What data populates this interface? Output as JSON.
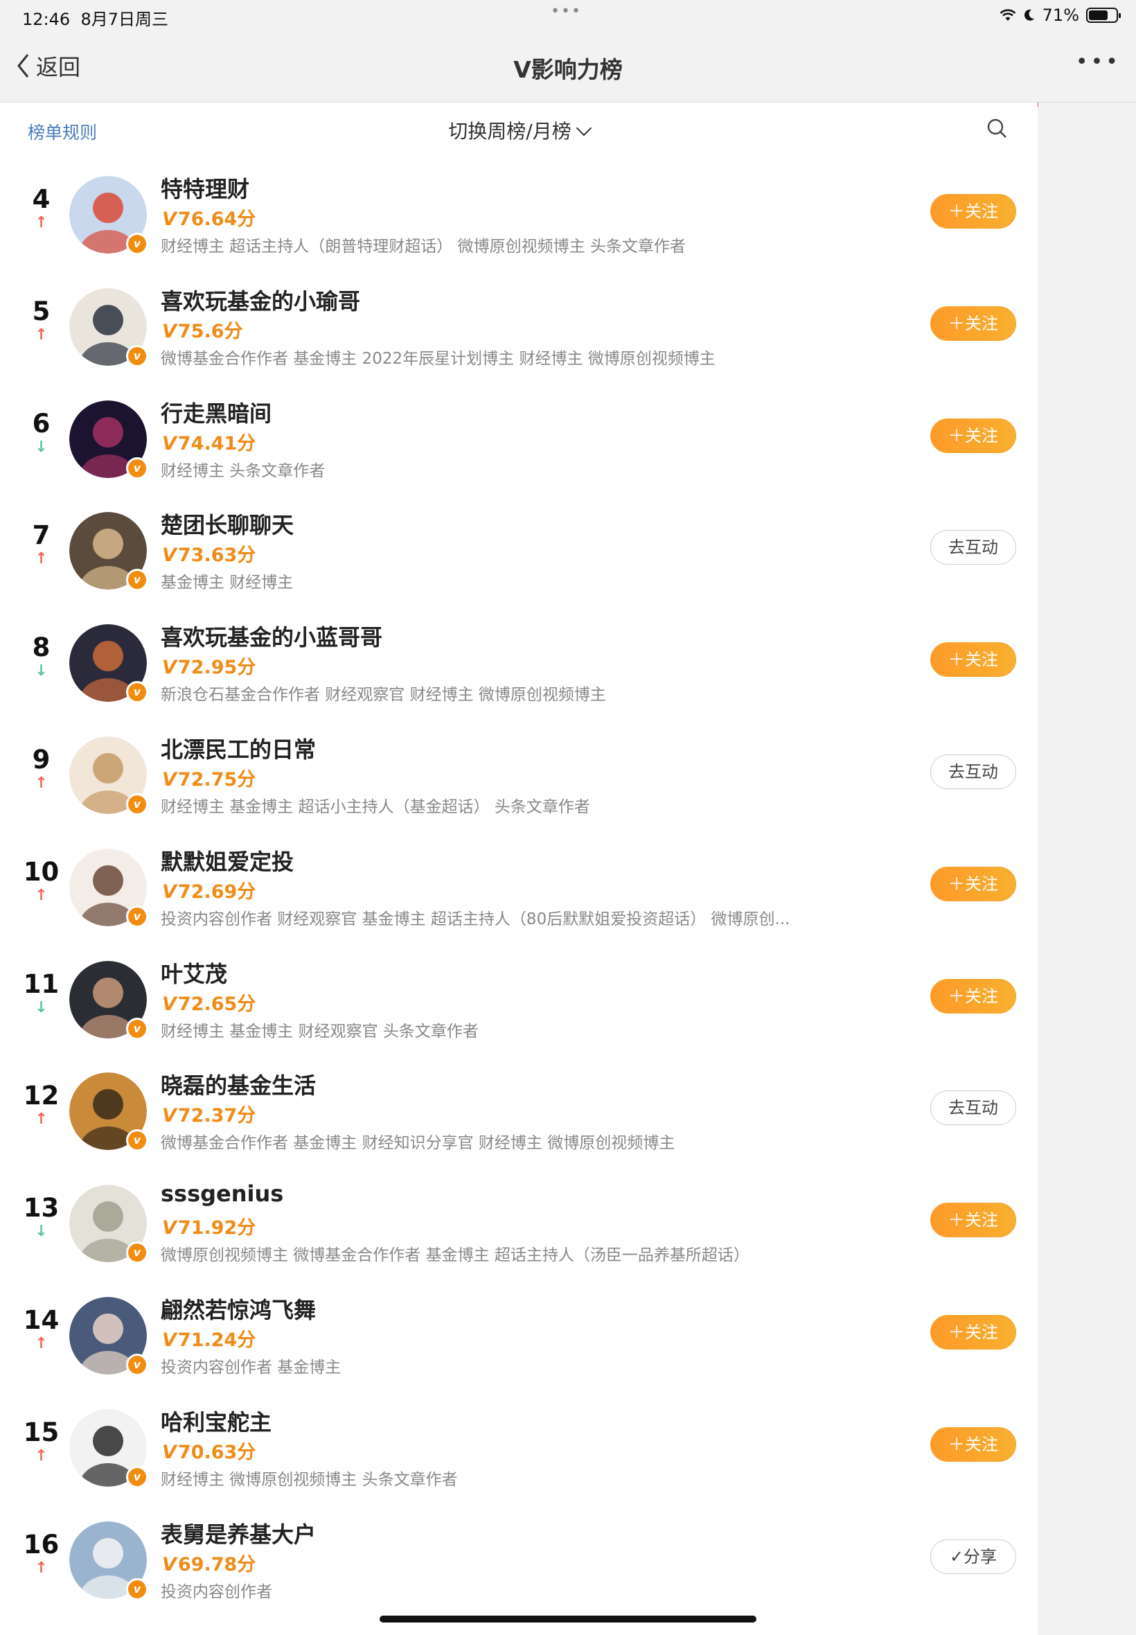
{
  "status_bar": {
    "time": "12:46",
    "date": "8月7日周三",
    "battery": "71%",
    "battery_level": 0.71
  },
  "nav": {
    "back_label": "返回",
    "title": "V影响力榜",
    "more_label": "•••"
  },
  "toolbar": {
    "rules_label": "榜单规则",
    "switch_label": "切换周榜/月榜"
  },
  "rows": [
    {
      "rank": "4",
      "trend": "up",
      "name": "特特理财",
      "score": "76.64分",
      "tags": "财经博主 超话主持人（朗普特理财超话） 微博原创视频博主 头条文章作者",
      "button": "＋关注",
      "button_type": "follow"
    },
    {
      "rank": "5",
      "trend": "up",
      "name": "喜欢玩基金的小瑜哥",
      "score": "75.6分",
      "tags": "微博基金合作作者 基金博主 2022年辰星计划博主 财经博主 微博原创视频博主",
      "button": "＋关注",
      "button_type": "follow"
    },
    {
      "rank": "6",
      "trend": "down",
      "name": "行走黑暗间",
      "score": "74.41分",
      "tags": "财经博主 头条文章作者",
      "button": "＋关注",
      "button_type": "follow"
    },
    {
      "rank": "7",
      "trend": "up",
      "name": "楚团长聊聊天",
      "score": "73.63分",
      "tags": "基金博主 财经博主",
      "button": "去互动",
      "button_type": "interact"
    },
    {
      "rank": "8",
      "trend": "down",
      "name": "喜欢玩基金的小蓝哥哥",
      "score": "72.95分",
      "tags": "新浪仓石基金合作作者 财经观察官 财经博主 微博原创视频博主",
      "button": "＋关注",
      "button_type": "follow"
    },
    {
      "rank": "9",
      "trend": "up",
      "name": "北漂民工的日常",
      "score": "72.75分",
      "tags": "财经博主 基金博主 超话小主持人（基金超话） 头条文章作者",
      "button": "去互动",
      "button_type": "interact"
    },
    {
      "rank": "10",
      "trend": "up",
      "name": "默默姐爱定投",
      "score": "72.69分",
      "tags": "投资内容创作者 财经观察官 基金博主 超话主持人（80后默默姐爱投资超话） 微博原创...",
      "button": "＋关注",
      "button_type": "follow"
    },
    {
      "rank": "11",
      "trend": "down",
      "name": "叶艾茂",
      "score": "72.65分",
      "tags": "财经博主 基金博主 财经观察官 头条文章作者",
      "button": "＋关注",
      "button_type": "follow"
    },
    {
      "rank": "12",
      "trend": "up",
      "name": "晓磊的基金生活",
      "score": "72.37分",
      "tags": "微博基金合作作者 基金博主 财经知识分享官 财经博主 微博原创视频博主",
      "button": "去互动",
      "button_type": "interact"
    },
    {
      "rank": "13",
      "trend": "down",
      "name": "sssgenius",
      "score": "71.92分",
      "tags": "微博原创视频博主 微博基金合作作者 基金博主 超话主持人（汤臣一品养基所超话）",
      "button": "＋关注",
      "button_type": "follow"
    },
    {
      "rank": "14",
      "trend": "up",
      "name": "翩然若惊鸿飞舞",
      "score": "71.24分",
      "tags": "投资内容创作者 基金博主",
      "button": "＋关注",
      "button_type": "follow"
    },
    {
      "rank": "15",
      "trend": "up",
      "name": "哈利宝舵主",
      "score": "70.63分",
      "tags": "财经博主 微博原创视频博主 头条文章作者",
      "button": "＋关注",
      "button_type": "follow"
    },
    {
      "rank": "16",
      "trend": "up",
      "name": "表舅是养基大户",
      "score": "69.78分",
      "tags": "投资内容创作者",
      "button": "✓分享",
      "button_type": "share"
    }
  ],
  "colors": {
    "accent_orange": "#f08c18",
    "link_blue": "#4a7cbf",
    "trend_up": "#f0655a",
    "trend_down": "#5cc4a8"
  },
  "icons": {
    "back": "chevron-left-icon",
    "search": "search-icon",
    "up": "arrow-up-icon",
    "down": "arrow-down-icon",
    "verified": "verified-badge-icon"
  }
}
